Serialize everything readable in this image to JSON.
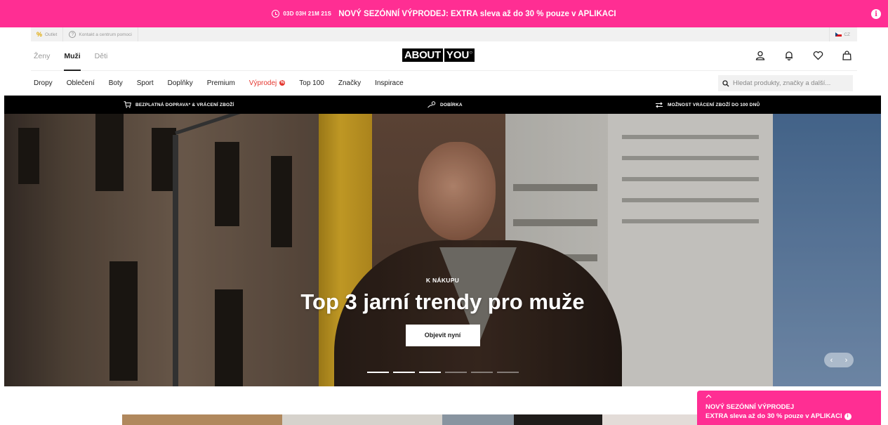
{
  "promo": {
    "timer": "03D 03H 21M 21S",
    "text": "NOVÝ SEZÓNNÍ VÝPRODEJ: EXTRA sleva až do 30 % pouze v APLIKACI",
    "info_icon": "info-icon"
  },
  "utility": {
    "outlet_label": "Outlet",
    "help_label": "Kontakt a centrum pomoci",
    "country_label": "CZ"
  },
  "header": {
    "genders": [
      "Ženy",
      "Muži",
      "Děti"
    ],
    "active_gender": "Muži",
    "logo_about": "ABOUT",
    "logo_you": "YOU",
    "icons": [
      "user-icon",
      "bell-icon",
      "heart-icon",
      "bag-icon"
    ]
  },
  "nav": {
    "items": [
      "Dropy",
      "Oblečení",
      "Boty",
      "Sport",
      "Doplňky",
      "Premium",
      "Výprodej",
      "Top 100",
      "Značky",
      "Inspirace"
    ],
    "sale_badge": "%",
    "search_placeholder": "Hledat produkty, značky a další..."
  },
  "usp": {
    "shipping": "BEZPLATNÁ DOPRAVA* & VRÁCENÍ ZBOŽÍ",
    "cod": "DOBÍRKA",
    "returns": "MOŽNOST VRÁCENÍ ZBOŽÍ DO 100 DNŮ"
  },
  "hero": {
    "kicker": "K NÁKUPU",
    "title": "Top 3 jarní trendy pro muže",
    "cta": "Objevit nyní",
    "slide_count": 6,
    "current_slide": 3,
    "prev_arrow": "‹",
    "next_arrow": "›"
  },
  "float_promo": {
    "line1": "NOVÝ SEZÓNNÍ VÝPRODEJ",
    "line2": "EXTRA sleva až do 30 % pouze v APLIKACI"
  },
  "colors": {
    "brand_pink": "#ff2e93",
    "sale_red": "#e5372f"
  }
}
